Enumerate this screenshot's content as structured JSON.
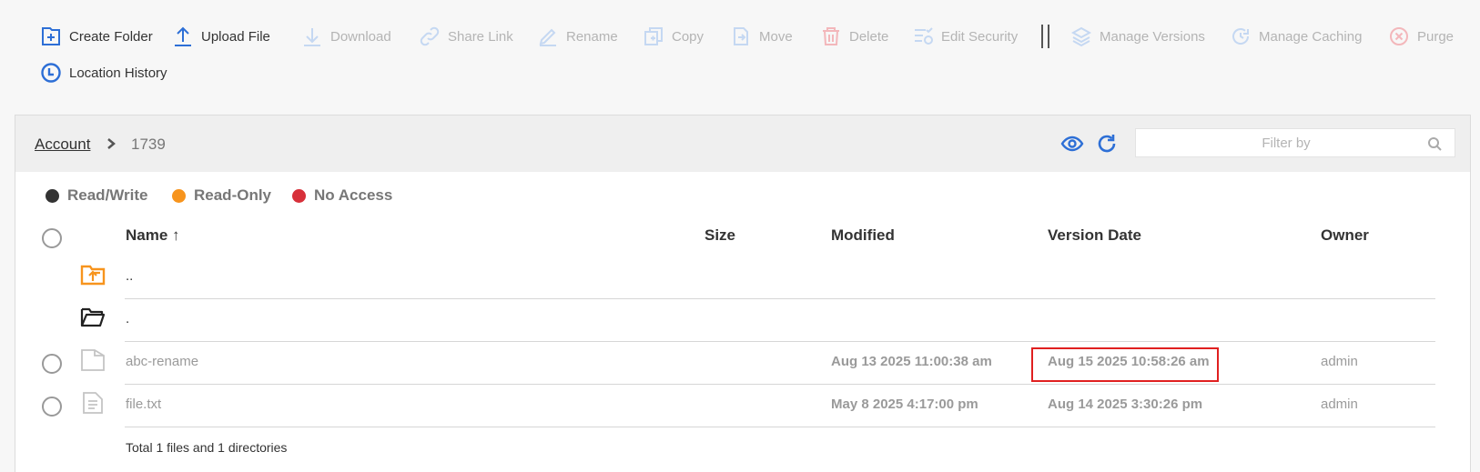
{
  "toolbar": {
    "create_folder": "Create Folder",
    "upload_file": "Upload File",
    "download": "Download",
    "share_link": "Share Link",
    "rename": "Rename",
    "copy": "Copy",
    "move": "Move",
    "delete": "Delete",
    "edit_security": "Edit Security",
    "manage_versions": "Manage Versions",
    "manage_caching": "Manage Caching",
    "purge": "Purge",
    "location_history": "Location History"
  },
  "breadcrumb": {
    "root": "Account",
    "current": "1739"
  },
  "filter": {
    "placeholder": "Filter by"
  },
  "legend": {
    "read_write": "Read/Write",
    "read_only": "Read-Only",
    "no_access": "No Access"
  },
  "columns": {
    "name": "Name",
    "sort_arrow": "↑",
    "size": "Size",
    "modified": "Modified",
    "version_date": "Version Date",
    "owner": "Owner"
  },
  "rows": [
    {
      "name": "..",
      "type": "parent-folder"
    },
    {
      "name": ".",
      "type": "current-folder"
    },
    {
      "name": "abc-rename",
      "size": "",
      "modified": "Aug 13 2025 11:00:38 am",
      "version_date": "Aug 15 2025 10:58:26 am",
      "owner": "admin",
      "type": "file"
    },
    {
      "name": "file.txt",
      "size": "",
      "modified": "May 8 2025 4:17:00 pm",
      "version_date": "Aug 14 2025 3:30:26 pm",
      "owner": "admin",
      "type": "text-file"
    }
  ],
  "footer": {
    "total": "Total 1 files and 1 directories"
  },
  "colors": {
    "accent": "#2d6fd6",
    "read_write": "#333333",
    "read_only": "#f7941d",
    "no_access": "#d7303a",
    "folder_up": "#f7941d",
    "highlight": "#e02020"
  }
}
